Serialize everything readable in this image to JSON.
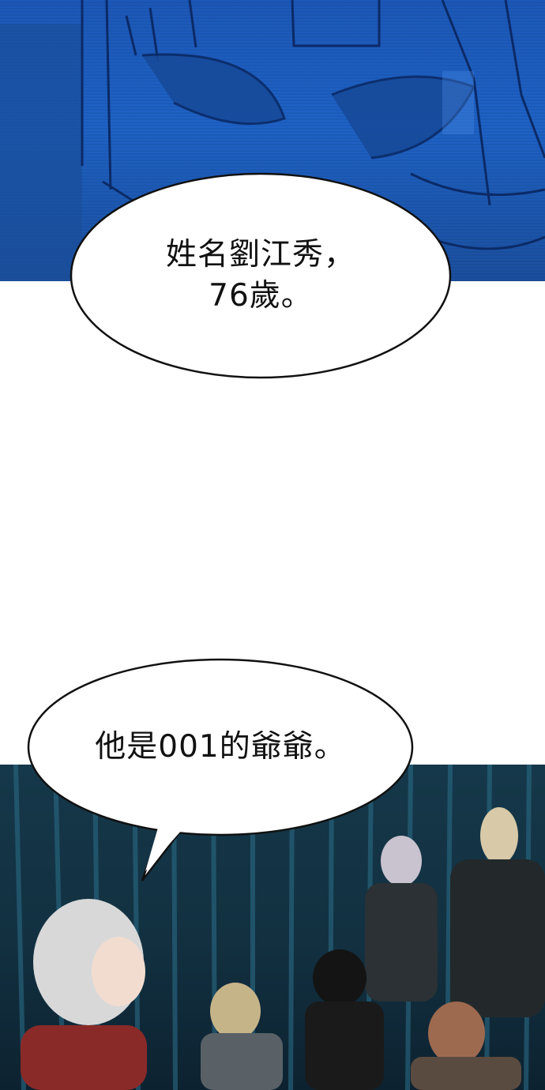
{
  "panels": {
    "top": {
      "description_color": "#1e62c6"
    },
    "bottom": {
      "description_color": "#15384a"
    }
  },
  "bubbles": {
    "first": {
      "text": "姓名劉江秀，\n76歲。"
    },
    "second": {
      "text": "他是001的爺爺。"
    }
  },
  "colors": {
    "sky_blue": "#1e62c6",
    "dark_teal": "#15384a",
    "bubble_fill": "#ffffff",
    "outline": "#111111"
  }
}
